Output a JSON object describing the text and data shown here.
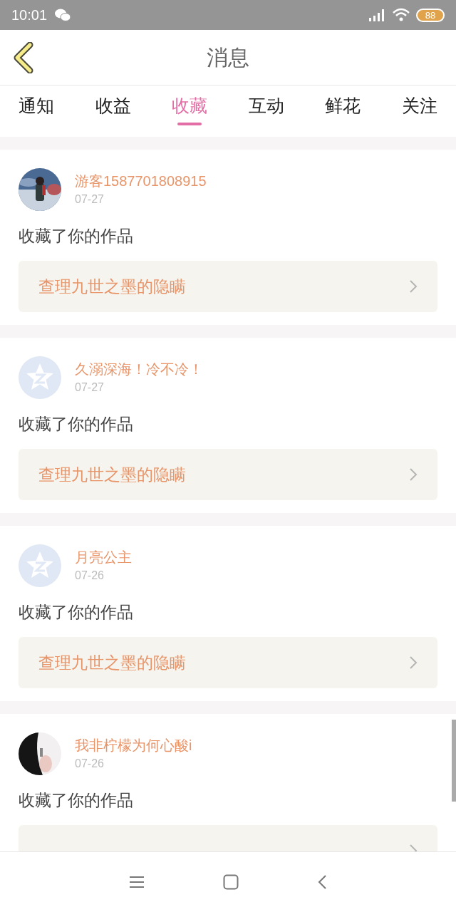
{
  "status_bar": {
    "time": "10:01",
    "battery": "88"
  },
  "header": {
    "title": "消息"
  },
  "tabs": [
    {
      "label": "通知",
      "selected": false
    },
    {
      "label": "收益",
      "selected": false
    },
    {
      "label": "收藏",
      "selected": true
    },
    {
      "label": "互动",
      "selected": false
    },
    {
      "label": "鲜花",
      "selected": false
    },
    {
      "label": "关注",
      "selected": false
    }
  ],
  "messages": [
    {
      "user": "游客1587701808915",
      "date": "07-27",
      "action": "收藏了你的作品",
      "work": "查理九世之墨的隐瞒"
    },
    {
      "avatar": {
        "kind": "default"
      },
      "user": "久溺深海！冷不冷！",
      "date": "07-27",
      "action": "收藏了你的作品",
      "work": "查理九世之墨的隐瞒"
    },
    {
      "avatar": {
        "kind": "default"
      },
      "user": "月亮公主",
      "date": "07-26",
      "action": "收藏了你的作品",
      "work": "查理九世之墨的隐瞒"
    },
    {
      "user": "我非柠檬为何心酸i",
      "date": "07-26",
      "action": "收藏了你的作品"
    }
  ]
}
